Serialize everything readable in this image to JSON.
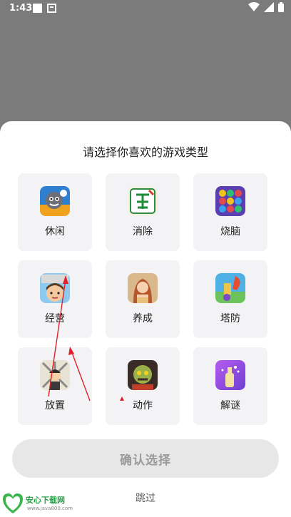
{
  "status_bar": {
    "time": "1:43"
  },
  "sheet": {
    "title": "请选择你喜欢的游戏类型",
    "categories": [
      {
        "label": "休闲",
        "icon": "casual-game-icon"
      },
      {
        "label": "消除",
        "icon": "mahjong-tile-icon"
      },
      {
        "label": "烧脑",
        "icon": "puzzle-dots-icon"
      },
      {
        "label": "经营",
        "icon": "management-game-icon"
      },
      {
        "label": "养成",
        "icon": "character-raising-icon"
      },
      {
        "label": "塔防",
        "icon": "tower-defense-icon"
      },
      {
        "label": "放置",
        "icon": "idle-game-icon"
      },
      {
        "label": "动作",
        "icon": "action-game-icon"
      },
      {
        "label": "解谜",
        "icon": "riddle-game-icon"
      }
    ],
    "confirm_label": "确认选择",
    "skip_label": "跳过"
  },
  "watermark": {
    "text": "安心下载网",
    "url": "www.java800.com"
  },
  "colors": {
    "overlay": "#7b7b7b",
    "sheet": "#ffffff",
    "card": "#f3f3f5",
    "button": "#e7e7e7",
    "annotation": "#e0212a"
  }
}
